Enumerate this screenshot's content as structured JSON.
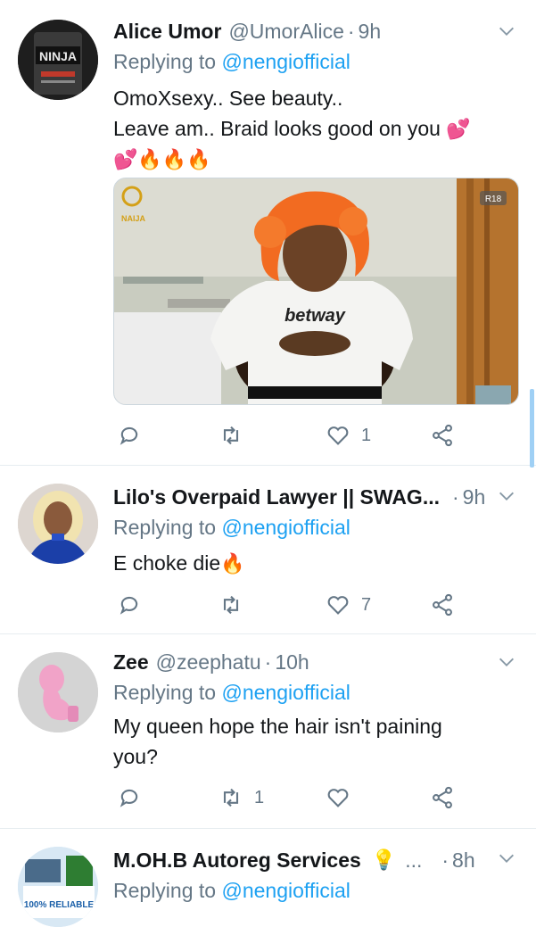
{
  "tweets": [
    {
      "name": "Alice Umor",
      "handle": "@UmorAlice",
      "time": "9h",
      "replying_prefix": "Replying to",
      "replying_to": "@nengiofficial",
      "text_line1": "OmoXsexy.. See beauty..",
      "text_line2": "Leave am.. Braid looks good on you",
      "media": {
        "badge": "R18",
        "shirt_text": "betway",
        "logo_text": "NAIJA"
      },
      "avatar_text": "NINJA",
      "reply_count": "",
      "retweet_count": "",
      "like_count": "1"
    },
    {
      "name": "Lilo's Overpaid Lawyer || SWAG...",
      "handle": "",
      "time": "9h",
      "replying_prefix": "Replying to",
      "replying_to": "@nengiofficial",
      "text_line1": "E choke die",
      "like_count": "7"
    },
    {
      "name": "Zee",
      "handle": "@zeephatu",
      "time": "10h",
      "replying_prefix": "Replying to",
      "replying_to": "@nengiofficial",
      "text_line1": "My queen hope the hair isn't paining",
      "text_line2": "you?",
      "retweet_count": "1"
    },
    {
      "name": "M.OH.B Autoreg Services",
      "extra": "...",
      "time": "8h",
      "replying_prefix": "Replying to",
      "replying_to": "@nengiofficial",
      "avatar_text": "100% RELIABLE"
    }
  ],
  "colors": {
    "accent": "#1da1f2",
    "secondary": "#657786",
    "divider": "#e6ecf0",
    "fire": "#f4900c",
    "heart_emoji": "#e0245e"
  }
}
